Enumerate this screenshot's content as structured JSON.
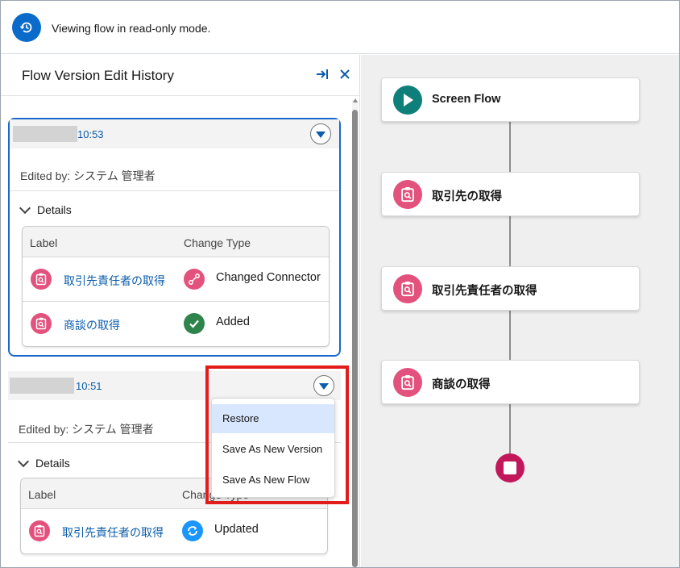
{
  "banner": {
    "text": "Viewing flow in read-only mode.",
    "icon": "history-icon"
  },
  "panel": {
    "title": "Flow Version Edit History",
    "actions": [
      {
        "icon": "collapse-panel-icon"
      },
      {
        "icon": "close-icon"
      }
    ]
  },
  "versions": [
    {
      "time": "10:53",
      "edited_by": "Edited by: システム 管理者",
      "details_label": "Details",
      "table_headers": {
        "label": "Label",
        "change_type": "Change Type"
      },
      "rows": [
        {
          "label": "取引先責任者の取得",
          "change_type": "Changed Connector"
        },
        {
          "label": "商談の取得",
          "change_type": "Added"
        }
      ]
    },
    {
      "time": "10:51",
      "edited_by": "Edited by: システム 管理者",
      "details_label": "Details",
      "table_headers": {
        "label": "Label",
        "change_type": "Change Type"
      },
      "rows": [
        {
          "label": "取引先責任者の取得",
          "change_type": "Updated"
        }
      ]
    }
  ],
  "dropdown": {
    "items": [
      "Restore",
      "Save As New Version",
      "Save As New Flow"
    ],
    "active": "Restore"
  },
  "canvas": {
    "nodes": [
      {
        "label": "Screen Flow",
        "icon": "play-icon"
      },
      {
        "label": "取引先の取得",
        "icon": "get-records-icon"
      },
      {
        "label": "取引先責任者の取得",
        "icon": "get-records-icon"
      },
      {
        "label": "商談の取得",
        "icon": "get-records-icon"
      }
    ],
    "end_icon": "stop-icon"
  },
  "colors": {
    "accent": "#0b6bcb",
    "link": "#0b5cab",
    "record_icon": "#e3527c",
    "start_icon": "#0f7f7a",
    "added": "#2e844a",
    "updated": "#1b96ff",
    "end": "#c2185b",
    "highlight": "#e21b1b"
  }
}
